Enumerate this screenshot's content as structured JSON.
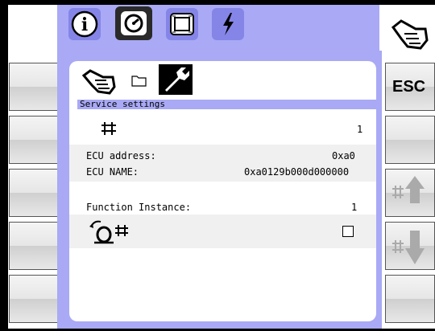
{
  "tabs": [
    {
      "name": "info-tab",
      "icon": "info-circle-icon"
    },
    {
      "name": "gauge-tab",
      "icon": "gauge-icon",
      "active": true
    },
    {
      "name": "screen-tab",
      "icon": "screen-frame-icon"
    },
    {
      "name": "power-tab",
      "icon": "lightning-icon"
    }
  ],
  "right_top_icon": "hand-icon",
  "header": {
    "breadcrumb_icons": [
      "hand-icon",
      "folder-icon",
      "wrench-icon"
    ],
    "title": "Service settings"
  },
  "network": {
    "icon": "network-icon",
    "value": "1"
  },
  "ecu": {
    "address_label": "ECU address:",
    "address_value": "0xa0",
    "name_label": "ECU NAME:",
    "name_value": "0xa0129b000d000000"
  },
  "function_instance": {
    "label": "Function Instance:",
    "value": "1"
  },
  "option_row": {
    "icon": "implement-network-icon",
    "checked": false
  },
  "softkeys": {
    "esc_label": "ESC",
    "up_icon": "network-up-arrow-icon",
    "down_icon": "network-down-arrow-icon"
  },
  "colors": {
    "panel": "#a9a9f5",
    "tab": "#8585e8",
    "active_tab": "#2a2a2a"
  }
}
